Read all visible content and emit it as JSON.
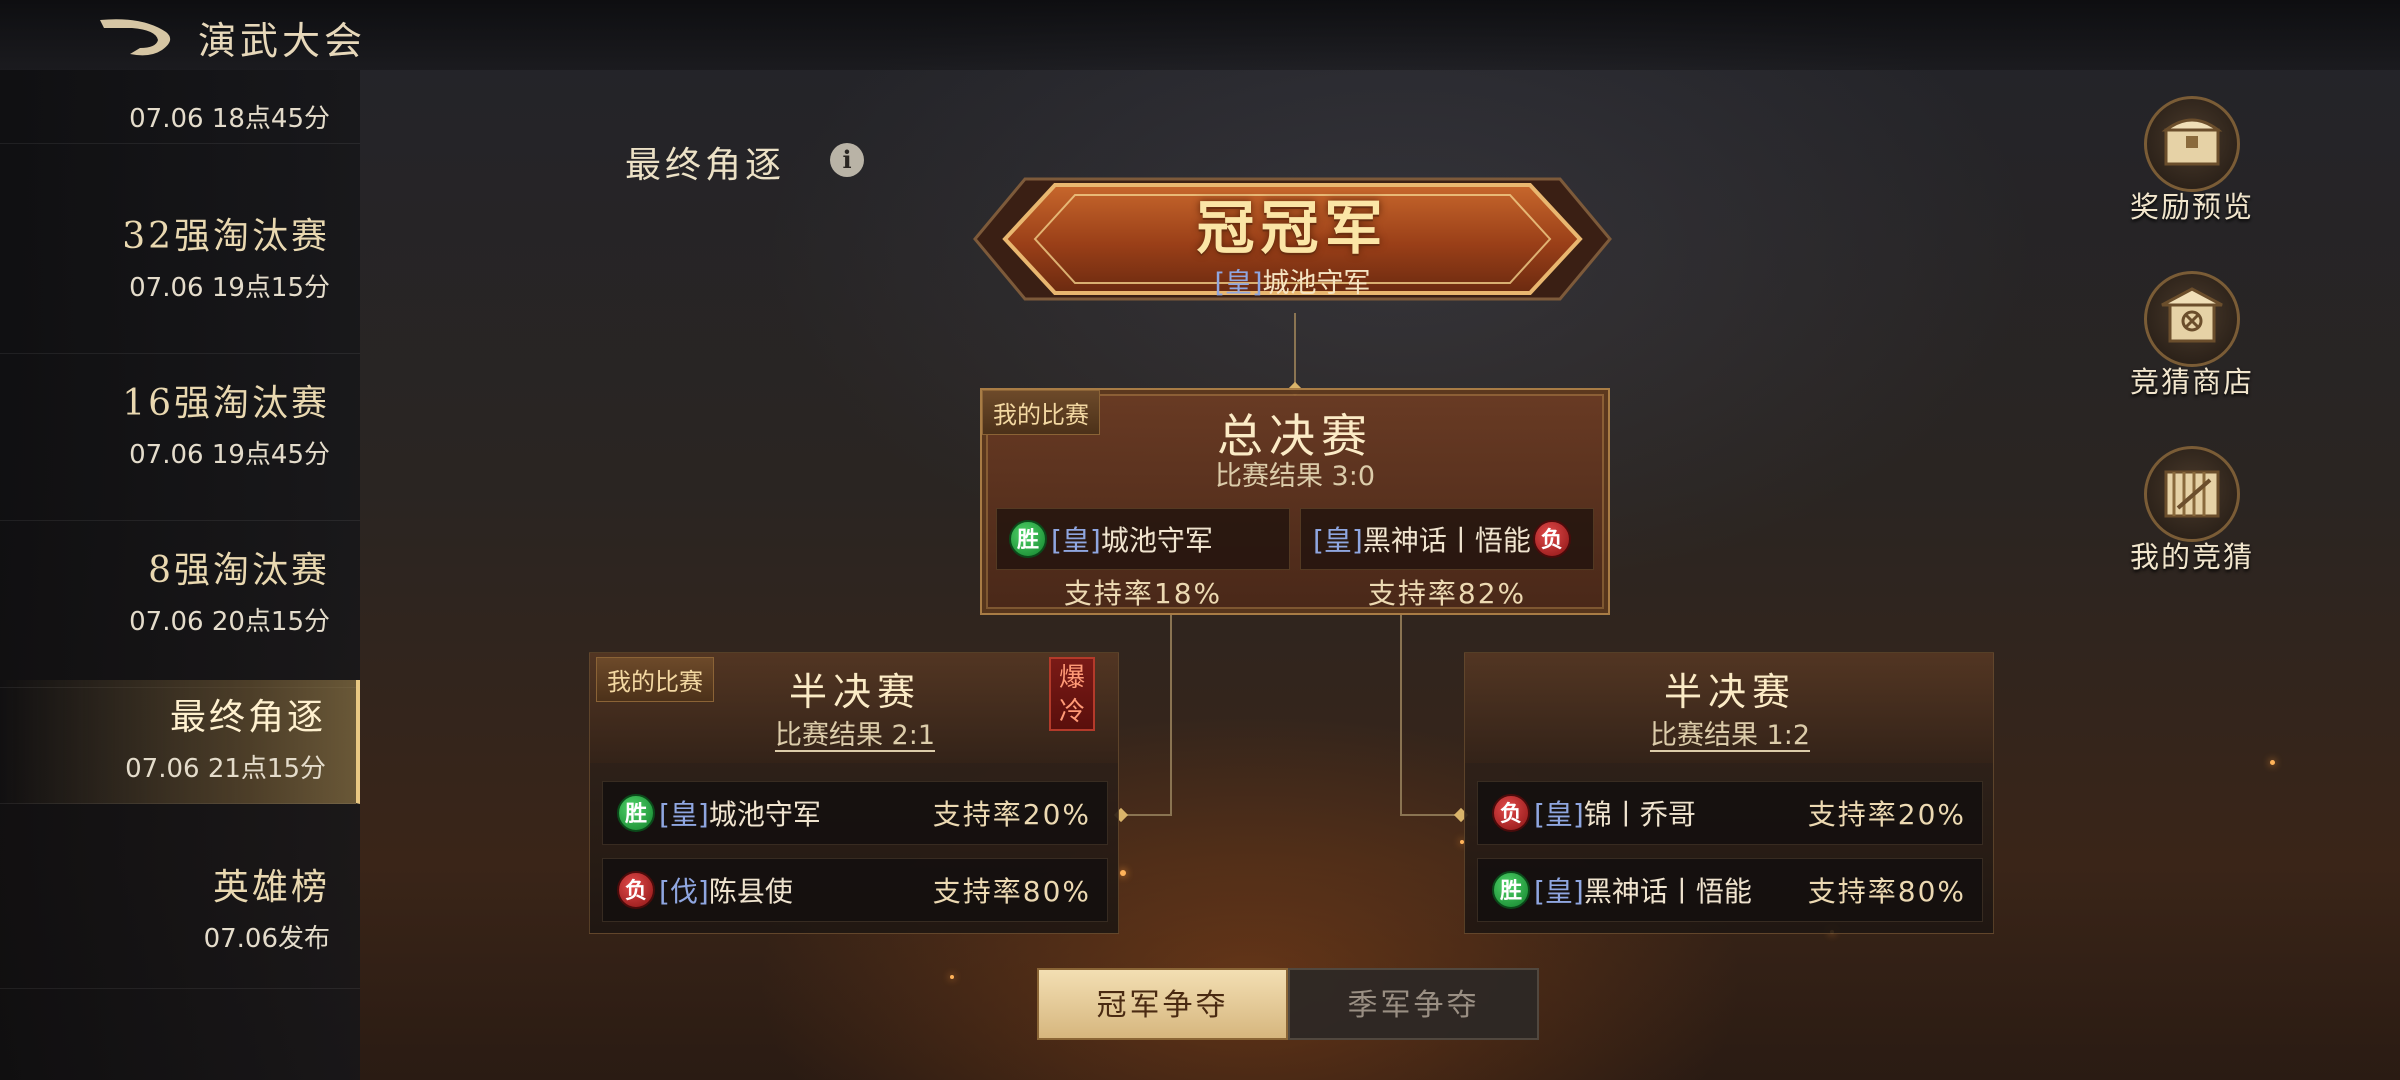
{
  "header": {
    "title": "演武大会"
  },
  "sidebar": {
    "items": [
      {
        "name": "",
        "time": "07.06 18点45分"
      },
      {
        "name": "32强淘汰赛",
        "time": "07.06 19点15分"
      },
      {
        "name": "16强淘汰赛",
        "time": "07.06 19点45分"
      },
      {
        "name": "8强淘汰赛",
        "time": "07.06 20点15分"
      },
      {
        "name": "最终角逐",
        "time": "07.06 21点15分",
        "active": true
      },
      {
        "name": "英雄榜",
        "time": "07.06发布"
      }
    ]
  },
  "section": {
    "title": "最终角逐"
  },
  "champion": {
    "title": "冠冠军",
    "tag": "[皇]",
    "team": "城池守军"
  },
  "final": {
    "my_match": "我的比赛",
    "title": "总决赛",
    "result": "比赛结果 3:0",
    "left": {
      "badge": "胜",
      "tag": "[皇]",
      "team": "城池守军",
      "support": "支持率18%"
    },
    "right": {
      "badge": "负",
      "tag": "[皇]",
      "team": "黑神话丨悟能",
      "support": "支持率82%"
    }
  },
  "semi_left": {
    "my_match": "我的比赛",
    "title": "半决赛",
    "result": "比赛结果 2:1",
    "upset": [
      "爆",
      "冷"
    ],
    "rows": [
      {
        "badge": "胜",
        "tag": "[皇]",
        "team": "城池守军",
        "rate": "支持率20%"
      },
      {
        "badge": "负",
        "tag": "[伐]",
        "team": "陈县使",
        "rate": "支持率80%"
      }
    ]
  },
  "semi_right": {
    "title": "半决赛",
    "result": "比赛结果 1:2",
    "rows": [
      {
        "badge": "负",
        "tag": "[皇]",
        "team": "锦丨乔哥",
        "rate": "支持率20%"
      },
      {
        "badge": "胜",
        "tag": "[皇]",
        "team": "黑神话丨悟能",
        "rate": "支持率80%"
      }
    ]
  },
  "tabs": [
    {
      "label": "冠军争夺",
      "active": true
    },
    {
      "label": "季军争夺",
      "active": false
    }
  ],
  "right_buttons": [
    {
      "label": "奖励预览",
      "icon": "treasure-chest-icon"
    },
    {
      "label": "竞猜商店",
      "icon": "shop-shrine-icon"
    },
    {
      "label": "我的竞猜",
      "icon": "betting-scroll-icon"
    }
  ],
  "colors": {
    "accent_gold": "#e9c883",
    "win_green": "#1f9a3a",
    "lose_red": "#b52222",
    "tag_blue": "#8fa6e0"
  }
}
